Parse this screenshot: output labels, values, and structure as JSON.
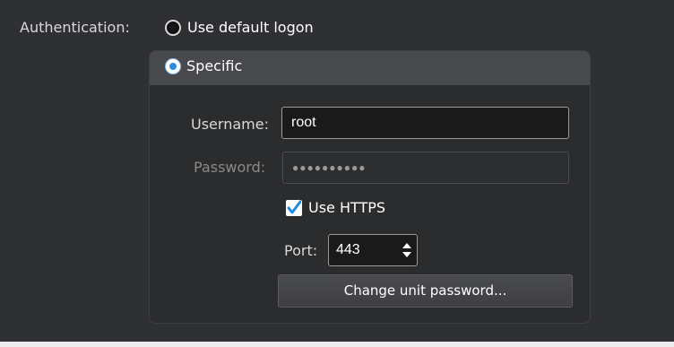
{
  "authentication": {
    "label": "Authentication:",
    "option_default": {
      "label": "Use default logon",
      "selected": false
    },
    "option_specific": {
      "label": "Specific",
      "selected": true
    }
  },
  "specific": {
    "username": {
      "label": "Username:",
      "value": "root"
    },
    "password": {
      "label": "Password:",
      "value": "●●●●●●●●●●",
      "enabled": false
    },
    "use_https": {
      "label": "Use HTTPS",
      "checked": true
    },
    "port": {
      "label": "Port:",
      "value": "443"
    },
    "change_password_button": "Change unit password..."
  },
  "colors": {
    "background": "#2f3033",
    "accent": "#2a8de0",
    "header": "#48494c"
  }
}
